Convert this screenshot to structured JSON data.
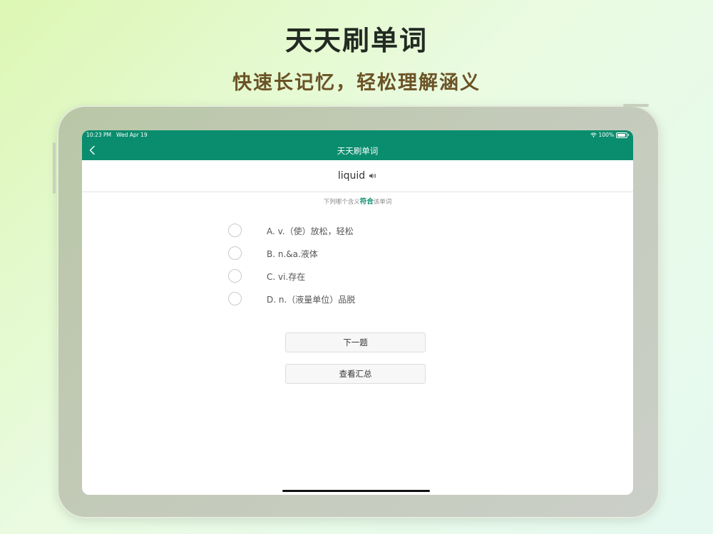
{
  "promo": {
    "title": "天天刷单词",
    "subtitle": "快速长记忆，轻松理解涵义"
  },
  "status_bar": {
    "time": "10:23 PM",
    "date": "Wed Apr 19",
    "battery": "100%"
  },
  "nav": {
    "title": "天天刷单词",
    "back_icon": "chevron-left-icon"
  },
  "question": {
    "word": "liquid",
    "speaker_icon": "speaker-icon",
    "hint_before": "下列哪个含义",
    "hint_emphasis": "符合",
    "hint_after": "该单词"
  },
  "options": [
    {
      "label": "A. v.（使）放松，轻松"
    },
    {
      "label": "B. n.&a.液体"
    },
    {
      "label": "C. vi.存在"
    },
    {
      "label": "D. n.（液量单位）品脱"
    }
  ],
  "buttons": {
    "next": "下一题",
    "summary": "查看汇总"
  },
  "colors": {
    "accent": "#0a8d6e",
    "promo_title": "#222a22",
    "promo_subtitle": "#6b5326"
  }
}
